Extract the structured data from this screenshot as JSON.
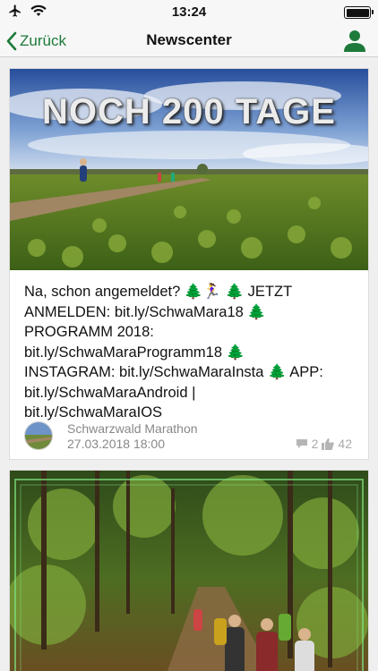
{
  "status_bar": {
    "time": "13:24",
    "icons": [
      "airplane-icon",
      "wifi-icon",
      "battery-icon"
    ]
  },
  "nav": {
    "back_label": "Zurück",
    "title": "Newscenter",
    "profile_icon": "person-icon",
    "accent_color": "#1d7a3a"
  },
  "posts": [
    {
      "image_overlay_text": "NOCH 200 TAGE",
      "text_lines": [
        "Na, schon angemeldet? 🌲🏃‍♀️ 🌲 JETZT",
        "ANMELDEN: bit.ly/SchwaMara18 🌲",
        "PROGRAMM 2018:",
        "bit.ly/SchwaMaraProgramm18 🌲",
        "INSTAGRAM: bit.ly/SchwaMaraInsta 🌲 APP:",
        "bit.ly/SchwaMaraAndroid |",
        "bit.ly/SchwaMaraIOS"
      ],
      "author": "Schwarzwald Marathon",
      "date": "27.03.2018 18:00",
      "comments": "2",
      "likes": "42"
    },
    {
      "image_overlay_text": ""
    }
  ]
}
